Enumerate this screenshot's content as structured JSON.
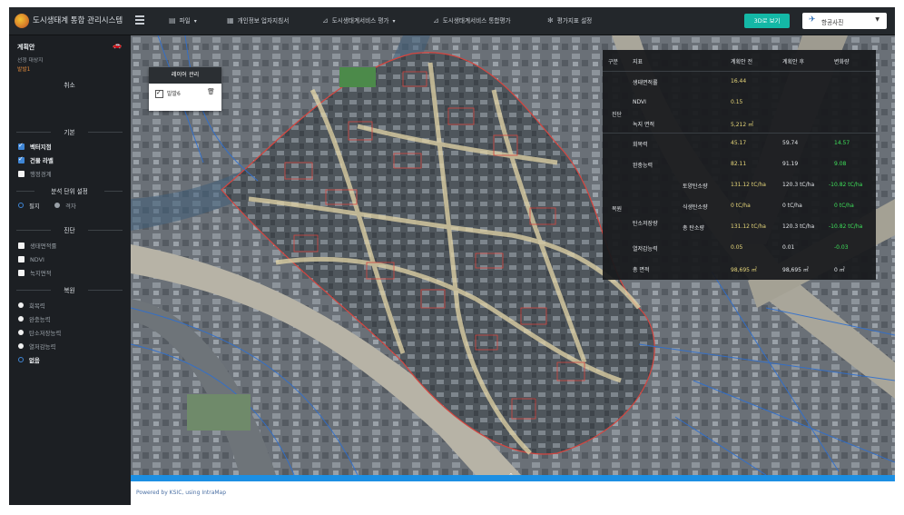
{
  "app": {
    "title": "도시생태계 통합 관리시스템"
  },
  "nav": {
    "menu_icon": "hamburger-icon",
    "items": [
      {
        "icon": "folder-icon",
        "label": "파일",
        "dropdown": true
      },
      {
        "icon": "document-icon",
        "label": "개인정보 업자지침서",
        "dropdown": false
      },
      {
        "icon": "chart-icon",
        "label": "도시생태계서비스 평가",
        "dropdown": true
      },
      {
        "icon": "chart-icon",
        "label": "도시생태계서비스 통합평가",
        "dropdown": false
      },
      {
        "icon": "gear-icon",
        "label": "평가지표 설정",
        "dropdown": false
      }
    ],
    "view3d_label": "3D로 보기",
    "basemap_selected": "항공사진",
    "accent_color": "#14b8a6"
  },
  "sidebar": {
    "title": "계획안",
    "subtitle": "선정 대상지",
    "status": "발발1",
    "cancel_label": "취소",
    "base_section": "기본",
    "base_items": [
      {
        "label": "벡터지점",
        "checked": true
      },
      {
        "label": "건물 라벨",
        "checked": true
      },
      {
        "label": "행정경계",
        "checked": false
      }
    ],
    "unit_section": "분석 단위 설정",
    "unit_options": [
      {
        "label": "필지",
        "selected": false
      },
      {
        "label": "격자",
        "selected": true
      }
    ],
    "diag_section": "진단",
    "diag_items": [
      {
        "label": "생태면적률",
        "checked": false
      },
      {
        "label": "NDVI",
        "checked": false
      },
      {
        "label": "녹지면적",
        "checked": false
      }
    ],
    "eval_section": "복원",
    "eval_items": [
      {
        "label": "회복력",
        "selected": false
      },
      {
        "label": "완충능력",
        "selected": false
      },
      {
        "label": "탄소저장능력",
        "selected": false
      },
      {
        "label": "열저감능력",
        "selected": false
      },
      {
        "label": "없음",
        "selected": true
      }
    ]
  },
  "layer_panel": {
    "title": "레이어 관리",
    "layer_label": "발발6",
    "checked": true
  },
  "result_table": {
    "headers": [
      "구분",
      "지표",
      "계획안 전",
      "계획안 후",
      "변화량"
    ],
    "group_diag": "진단",
    "group_rest": "복원",
    "carbon_label": "탄소저장량",
    "rows": [
      {
        "label": "생태면적률",
        "before": "16.44",
        "after": "",
        "change": ""
      },
      {
        "label": "NDVI",
        "before": "0.15",
        "after": "",
        "change": ""
      },
      {
        "label": "녹지 면적",
        "before": "5,212 ㎡",
        "after": "",
        "change": ""
      },
      {
        "label": "회복력",
        "before": "45.17",
        "after": "59.74",
        "change": "14.57"
      },
      {
        "label": "완충능력",
        "before": "82.11",
        "after": "91.19",
        "change": "9.08"
      },
      {
        "label": "토양탄소량",
        "before": "131.12 tC/ha",
        "after": "120.3 tC/ha",
        "change": "-10.82 tC/ha"
      },
      {
        "label": "식생탄소량",
        "before": "0 tC/ha",
        "after": "0 tC/ha",
        "change": "0 tC/ha"
      },
      {
        "label": "총 탄소량",
        "before": "131.12 tC/ha",
        "after": "120.3 tC/ha",
        "change": "-10.82 tC/ha"
      },
      {
        "label": "열저감능력",
        "before": "0.05",
        "after": "0.01",
        "change": "-0.03"
      },
      {
        "label": "총 면적",
        "before": "98,695 ㎡",
        "after": "98,695 ㎡",
        "change": "0 ㎡"
      }
    ]
  },
  "footer": {
    "text": "Powered by KSIC, using IntraMap"
  }
}
